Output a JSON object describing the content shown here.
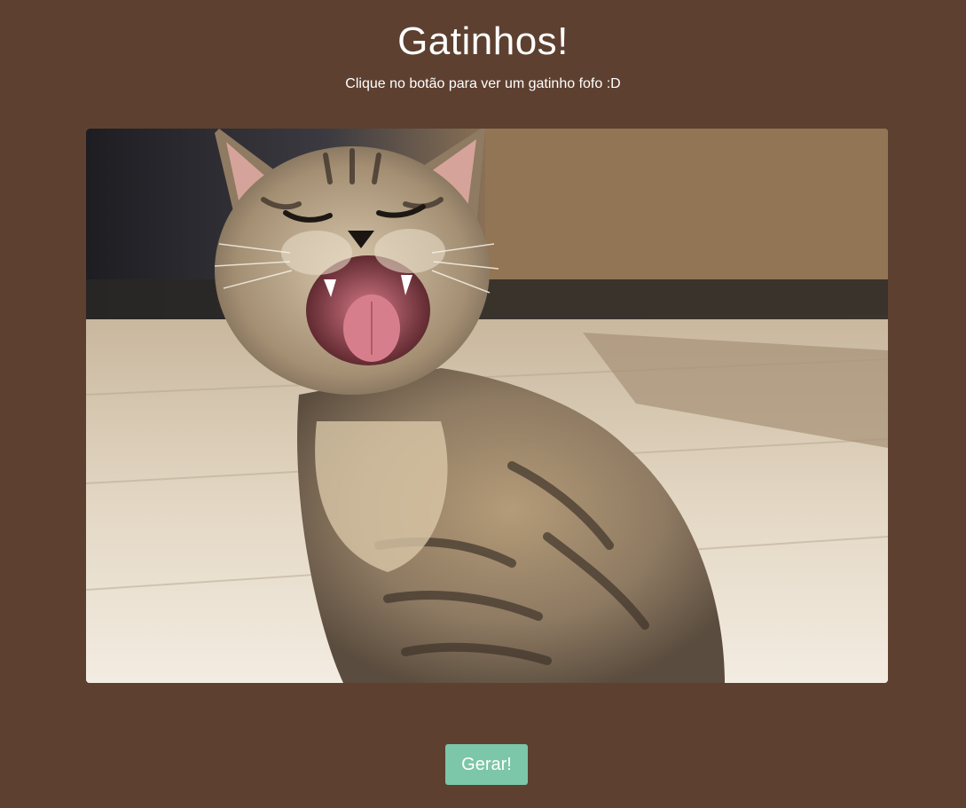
{
  "header": {
    "title": "Gatinhos!",
    "subtitle": "Clique no botão para ver um gatinho fofo :D"
  },
  "image": {
    "subject": "kitten-yawning"
  },
  "actions": {
    "generate_label": "Gerar!"
  },
  "colors": {
    "background": "#5d4030",
    "button": "#7cc6a9",
    "text": "#ffffff"
  }
}
